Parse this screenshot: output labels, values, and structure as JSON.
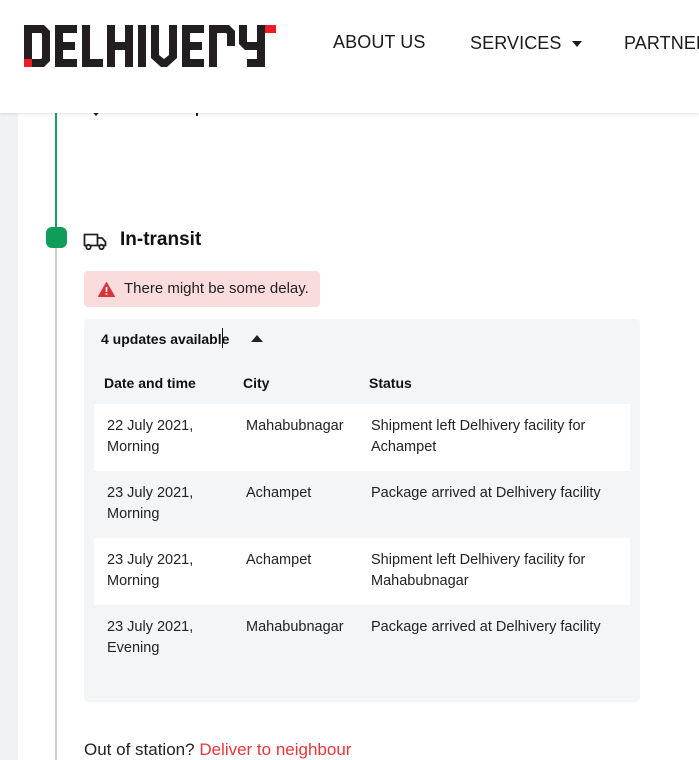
{
  "brand": {
    "logo_text": "DELHIVERY",
    "logo_color": "#231f20",
    "accent_color": "#ed1c24"
  },
  "nav": {
    "about": "ABOUT US",
    "services": "SERVICES",
    "partner": "PARTNER"
  },
  "timeline": {
    "active_color": "#0f9d58",
    "step_icon": "truck-icon",
    "step_title": "In-transit"
  },
  "delay": {
    "icon": "warning-icon",
    "message": "There might be some delay.",
    "bg_color": "#fbdcdc"
  },
  "updates": {
    "toggle_label": "4 updates available",
    "columns": [
      "Date and time",
      "City",
      "Status"
    ],
    "rows": [
      {
        "date": "22 July 2021, Morning",
        "city": "Mahabubnagar",
        "status": "Shipment left Delhivery facility for Achampet"
      },
      {
        "date": "23 July 2021, Morning",
        "city": "Achampet",
        "status": "Package arrived at Delhivery facility"
      },
      {
        "date": "23 July 2021, Morning",
        "city": "Achampet",
        "status": "Shipment left Delhivery facility for Mahabubnagar"
      },
      {
        "date": "23 July 2021, Evening",
        "city": "Mahabubnagar",
        "status": "Package arrived at Delhivery facility"
      }
    ]
  },
  "footer": {
    "question": "Out of station?",
    "link": "Deliver to neighbour",
    "link_color": "#e8363a"
  }
}
